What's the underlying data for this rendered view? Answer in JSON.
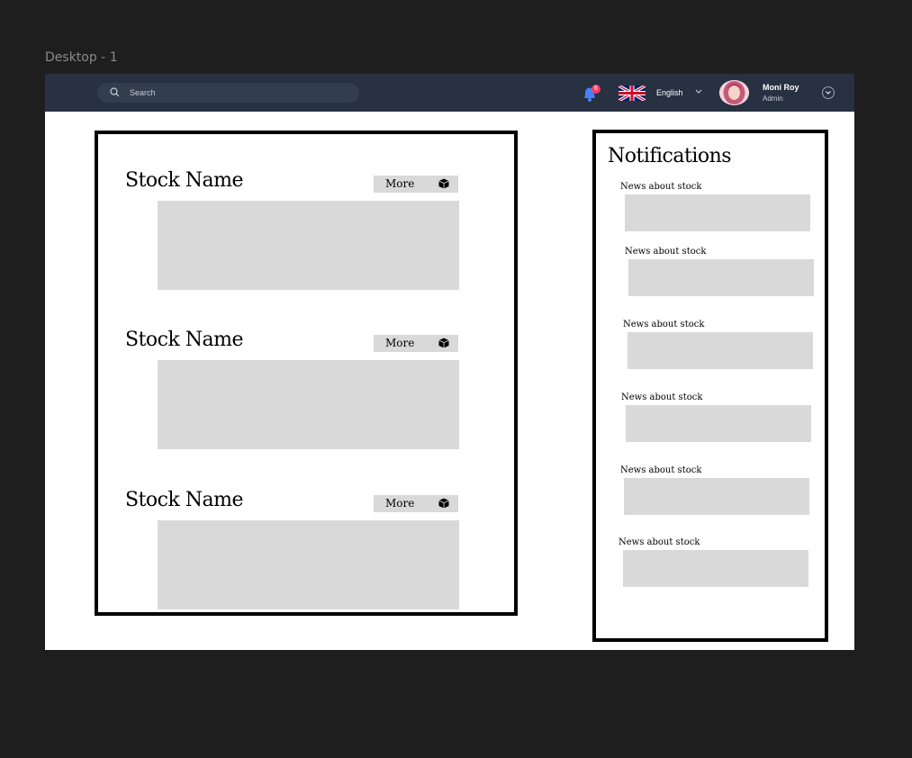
{
  "canvas": {
    "frame_label": "Desktop - 1"
  },
  "header": {
    "search": {
      "placeholder": "Search"
    },
    "notifications": {
      "count": "6",
      "color": "#4880ff",
      "badge_color": "#f93c65"
    },
    "language": {
      "label": "English",
      "flag_icon": "uk-flag-icon"
    },
    "user": {
      "name": "Moni Roy",
      "role": "Admin"
    },
    "background_color": "#273142"
  },
  "stocks": {
    "items": [
      {
        "name": "Stock Name",
        "more_label": "More"
      },
      {
        "name": "Stock Name",
        "more_label": "More"
      },
      {
        "name": "Stock Name",
        "more_label": "More"
      }
    ]
  },
  "notifications": {
    "title": "Notifications",
    "items": [
      {
        "label": "News about stock"
      },
      {
        "label": "News about stock"
      },
      {
        "label": "News about stock"
      },
      {
        "label": "News about stock"
      },
      {
        "label": "News about stock"
      },
      {
        "label": "News about stock"
      }
    ]
  }
}
